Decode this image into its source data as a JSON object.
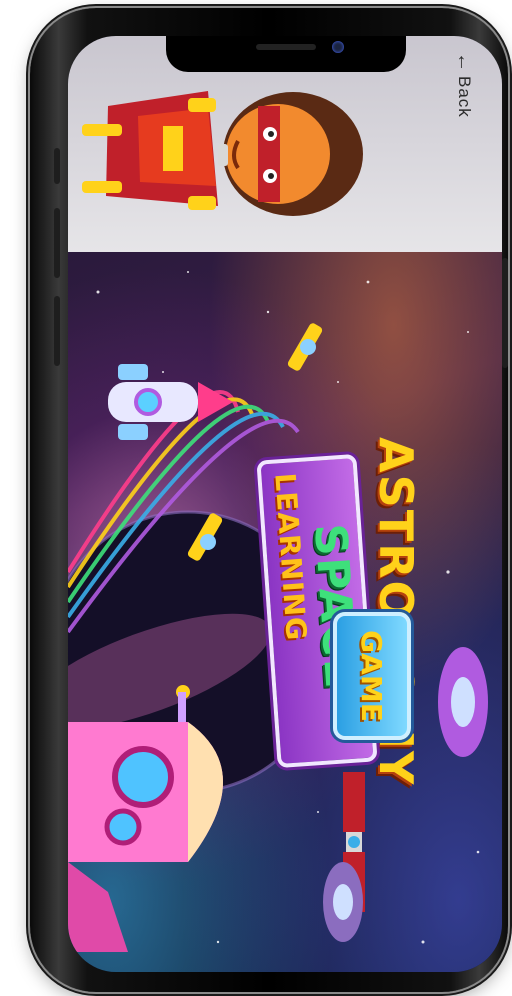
{
  "header": {
    "back_label": "Back",
    "back_icon": "arrow-left-icon"
  },
  "game": {
    "title_line1": "ASTRONOMY",
    "title_line2": "SPACE",
    "title_line3": "LEARNING",
    "badge_label": "GAME"
  },
  "colors": {
    "title_yellow": "#ffd21a",
    "title_green": "#3ee07b",
    "panel_purple": "#b05be0",
    "badge_blue": "#3aaee8"
  }
}
